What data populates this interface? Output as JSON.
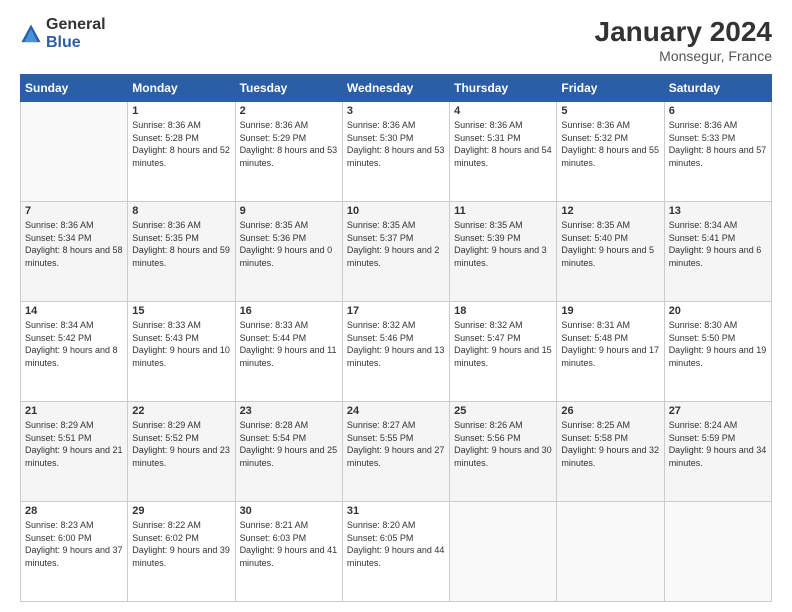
{
  "logo": {
    "general": "General",
    "blue": "Blue"
  },
  "header": {
    "title": "January 2024",
    "subtitle": "Monsegur, France"
  },
  "days_header": [
    "Sunday",
    "Monday",
    "Tuesday",
    "Wednesday",
    "Thursday",
    "Friday",
    "Saturday"
  ],
  "weeks": [
    [
      {
        "day": "",
        "sunrise": "",
        "sunset": "",
        "daylight": ""
      },
      {
        "day": "1",
        "sunrise": "Sunrise: 8:36 AM",
        "sunset": "Sunset: 5:28 PM",
        "daylight": "Daylight: 8 hours and 52 minutes."
      },
      {
        "day": "2",
        "sunrise": "Sunrise: 8:36 AM",
        "sunset": "Sunset: 5:29 PM",
        "daylight": "Daylight: 8 hours and 53 minutes."
      },
      {
        "day": "3",
        "sunrise": "Sunrise: 8:36 AM",
        "sunset": "Sunset: 5:30 PM",
        "daylight": "Daylight: 8 hours and 53 minutes."
      },
      {
        "day": "4",
        "sunrise": "Sunrise: 8:36 AM",
        "sunset": "Sunset: 5:31 PM",
        "daylight": "Daylight: 8 hours and 54 minutes."
      },
      {
        "day": "5",
        "sunrise": "Sunrise: 8:36 AM",
        "sunset": "Sunset: 5:32 PM",
        "daylight": "Daylight: 8 hours and 55 minutes."
      },
      {
        "day": "6",
        "sunrise": "Sunrise: 8:36 AM",
        "sunset": "Sunset: 5:33 PM",
        "daylight": "Daylight: 8 hours and 57 minutes."
      }
    ],
    [
      {
        "day": "7",
        "sunrise": "Sunrise: 8:36 AM",
        "sunset": "Sunset: 5:34 PM",
        "daylight": "Daylight: 8 hours and 58 minutes."
      },
      {
        "day": "8",
        "sunrise": "Sunrise: 8:36 AM",
        "sunset": "Sunset: 5:35 PM",
        "daylight": "Daylight: 8 hours and 59 minutes."
      },
      {
        "day": "9",
        "sunrise": "Sunrise: 8:35 AM",
        "sunset": "Sunset: 5:36 PM",
        "daylight": "Daylight: 9 hours and 0 minutes."
      },
      {
        "day": "10",
        "sunrise": "Sunrise: 8:35 AM",
        "sunset": "Sunset: 5:37 PM",
        "daylight": "Daylight: 9 hours and 2 minutes."
      },
      {
        "day": "11",
        "sunrise": "Sunrise: 8:35 AM",
        "sunset": "Sunset: 5:39 PM",
        "daylight": "Daylight: 9 hours and 3 minutes."
      },
      {
        "day": "12",
        "sunrise": "Sunrise: 8:35 AM",
        "sunset": "Sunset: 5:40 PM",
        "daylight": "Daylight: 9 hours and 5 minutes."
      },
      {
        "day": "13",
        "sunrise": "Sunrise: 8:34 AM",
        "sunset": "Sunset: 5:41 PM",
        "daylight": "Daylight: 9 hours and 6 minutes."
      }
    ],
    [
      {
        "day": "14",
        "sunrise": "Sunrise: 8:34 AM",
        "sunset": "Sunset: 5:42 PM",
        "daylight": "Daylight: 9 hours and 8 minutes."
      },
      {
        "day": "15",
        "sunrise": "Sunrise: 8:33 AM",
        "sunset": "Sunset: 5:43 PM",
        "daylight": "Daylight: 9 hours and 10 minutes."
      },
      {
        "day": "16",
        "sunrise": "Sunrise: 8:33 AM",
        "sunset": "Sunset: 5:44 PM",
        "daylight": "Daylight: 9 hours and 11 minutes."
      },
      {
        "day": "17",
        "sunrise": "Sunrise: 8:32 AM",
        "sunset": "Sunset: 5:46 PM",
        "daylight": "Daylight: 9 hours and 13 minutes."
      },
      {
        "day": "18",
        "sunrise": "Sunrise: 8:32 AM",
        "sunset": "Sunset: 5:47 PM",
        "daylight": "Daylight: 9 hours and 15 minutes."
      },
      {
        "day": "19",
        "sunrise": "Sunrise: 8:31 AM",
        "sunset": "Sunset: 5:48 PM",
        "daylight": "Daylight: 9 hours and 17 minutes."
      },
      {
        "day": "20",
        "sunrise": "Sunrise: 8:30 AM",
        "sunset": "Sunset: 5:50 PM",
        "daylight": "Daylight: 9 hours and 19 minutes."
      }
    ],
    [
      {
        "day": "21",
        "sunrise": "Sunrise: 8:29 AM",
        "sunset": "Sunset: 5:51 PM",
        "daylight": "Daylight: 9 hours and 21 minutes."
      },
      {
        "day": "22",
        "sunrise": "Sunrise: 8:29 AM",
        "sunset": "Sunset: 5:52 PM",
        "daylight": "Daylight: 9 hours and 23 minutes."
      },
      {
        "day": "23",
        "sunrise": "Sunrise: 8:28 AM",
        "sunset": "Sunset: 5:54 PM",
        "daylight": "Daylight: 9 hours and 25 minutes."
      },
      {
        "day": "24",
        "sunrise": "Sunrise: 8:27 AM",
        "sunset": "Sunset: 5:55 PM",
        "daylight": "Daylight: 9 hours and 27 minutes."
      },
      {
        "day": "25",
        "sunrise": "Sunrise: 8:26 AM",
        "sunset": "Sunset: 5:56 PM",
        "daylight": "Daylight: 9 hours and 30 minutes."
      },
      {
        "day": "26",
        "sunrise": "Sunrise: 8:25 AM",
        "sunset": "Sunset: 5:58 PM",
        "daylight": "Daylight: 9 hours and 32 minutes."
      },
      {
        "day": "27",
        "sunrise": "Sunrise: 8:24 AM",
        "sunset": "Sunset: 5:59 PM",
        "daylight": "Daylight: 9 hours and 34 minutes."
      }
    ],
    [
      {
        "day": "28",
        "sunrise": "Sunrise: 8:23 AM",
        "sunset": "Sunset: 6:00 PM",
        "daylight": "Daylight: 9 hours and 37 minutes."
      },
      {
        "day": "29",
        "sunrise": "Sunrise: 8:22 AM",
        "sunset": "Sunset: 6:02 PM",
        "daylight": "Daylight: 9 hours and 39 minutes."
      },
      {
        "day": "30",
        "sunrise": "Sunrise: 8:21 AM",
        "sunset": "Sunset: 6:03 PM",
        "daylight": "Daylight: 9 hours and 41 minutes."
      },
      {
        "day": "31",
        "sunrise": "Sunrise: 8:20 AM",
        "sunset": "Sunset: 6:05 PM",
        "daylight": "Daylight: 9 hours and 44 minutes."
      },
      {
        "day": "",
        "sunrise": "",
        "sunset": "",
        "daylight": ""
      },
      {
        "day": "",
        "sunrise": "",
        "sunset": "",
        "daylight": ""
      },
      {
        "day": "",
        "sunrise": "",
        "sunset": "",
        "daylight": ""
      }
    ]
  ]
}
